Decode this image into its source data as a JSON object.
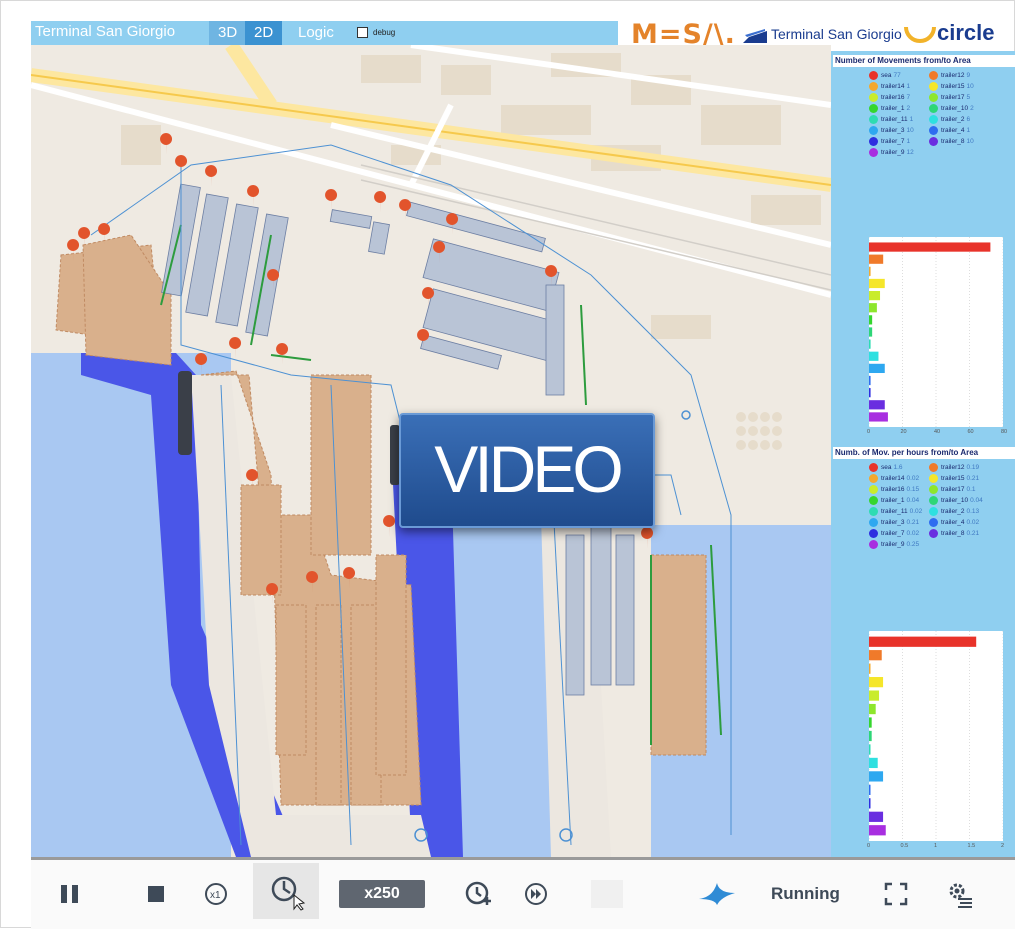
{
  "header": {
    "title": "Terminal San Giorgio",
    "view_tabs": [
      "3D",
      "2D",
      "Logic"
    ],
    "debug_label": "debug",
    "brand_mesa": "M=S/\\.",
    "brand_terminal": "Terminal San Giorgio",
    "brand_circle": "circle"
  },
  "video_overlay": {
    "label": "VIDEO"
  },
  "panel_movements": {
    "title": "Number of Movements from/to Area",
    "legend": [
      {
        "name": "sea",
        "value": "77",
        "color": "#e8332a"
      },
      {
        "name": "trailer12",
        "value": "9",
        "color": "#f07a2a"
      },
      {
        "name": "trailer14",
        "value": "1",
        "color": "#f3a82e"
      },
      {
        "name": "trailer15",
        "value": "10",
        "color": "#f5e62a"
      },
      {
        "name": "trailer16",
        "value": "7",
        "color": "#c9ec2c"
      },
      {
        "name": "trailer17",
        "value": "5",
        "color": "#8ee62c"
      },
      {
        "name": "trailer_1",
        "value": "2",
        "color": "#35d62e"
      },
      {
        "name": "trailer_10",
        "value": "2",
        "color": "#2ed677"
      },
      {
        "name": "trailer_11",
        "value": "1",
        "color": "#2edcb2"
      },
      {
        "name": "trailer_2",
        "value": "6",
        "color": "#2ee0e0"
      },
      {
        "name": "trailer_3",
        "value": "10",
        "color": "#2ea8f0"
      },
      {
        "name": "trailer_4",
        "value": "1",
        "color": "#2e6cf0"
      },
      {
        "name": "trailer_7",
        "value": "1",
        "color": "#2e2ee0"
      },
      {
        "name": "trailer_8",
        "value": "10",
        "color": "#6a2ee0"
      },
      {
        "name": "trailer_9",
        "value": "12",
        "color": "#a82ee0"
      }
    ],
    "axis_ticks": [
      "0",
      "20",
      "40",
      "60",
      "80"
    ]
  },
  "panel_hourly": {
    "title": "Numb. of Mov. per hours from/to Area",
    "legend": [
      {
        "name": "sea",
        "value": "1.6",
        "color": "#e8332a"
      },
      {
        "name": "trailer12",
        "value": "0.19",
        "color": "#f07a2a"
      },
      {
        "name": "trailer14",
        "value": "0.02",
        "color": "#f3a82e"
      },
      {
        "name": "trailer15",
        "value": "0.21",
        "color": "#f5e62a"
      },
      {
        "name": "trailer16",
        "value": "0.15",
        "color": "#c9ec2c"
      },
      {
        "name": "trailer17",
        "value": "0.1",
        "color": "#8ee62c"
      },
      {
        "name": "trailer_1",
        "value": "0.04",
        "color": "#35d62e"
      },
      {
        "name": "trailer_10",
        "value": "0.04",
        "color": "#2ed677"
      },
      {
        "name": "trailer_11",
        "value": "0.02",
        "color": "#2edcb2"
      },
      {
        "name": "trailer_2",
        "value": "0.13",
        "color": "#2ee0e0"
      },
      {
        "name": "trailer_3",
        "value": "0.21",
        "color": "#2ea8f0"
      },
      {
        "name": "trailer_4",
        "value": "0.02",
        "color": "#2e6cf0"
      },
      {
        "name": "trailer_7",
        "value": "0.02",
        "color": "#2e2ee0"
      },
      {
        "name": "trailer_8",
        "value": "0.21",
        "color": "#6a2ee0"
      },
      {
        "name": "trailer_9",
        "value": "0.25",
        "color": "#a82ee0"
      }
    ],
    "axis_ticks": [
      "0",
      "0.5",
      "1",
      "1.5",
      "2"
    ]
  },
  "chart_data": [
    {
      "type": "bar",
      "title": "Number of Movements from/to Area",
      "orientation": "horizontal",
      "categories": [
        "sea",
        "trailer12",
        "trailer14",
        "trailer15",
        "trailer16",
        "trailer17",
        "trailer_1",
        "trailer_10",
        "trailer_11",
        "trailer_2",
        "trailer_3",
        "trailer_4",
        "trailer_7",
        "trailer_8",
        "trailer_9"
      ],
      "values": [
        77,
        9,
        1,
        10,
        7,
        5,
        2,
        2,
        1,
        6,
        10,
        1,
        1,
        10,
        12
      ],
      "xlim": [
        0,
        85
      ]
    },
    {
      "type": "bar",
      "title": "Numb. of Mov. per hours from/to Area",
      "orientation": "horizontal",
      "categories": [
        "sea",
        "trailer12",
        "trailer14",
        "trailer15",
        "trailer16",
        "trailer17",
        "trailer_1",
        "trailer_10",
        "trailer_11",
        "trailer_2",
        "trailer_3",
        "trailer_4",
        "trailer_7",
        "trailer_8",
        "trailer_9"
      ],
      "values": [
        1.6,
        0.19,
        0.02,
        0.21,
        0.15,
        0.1,
        0.04,
        0.04,
        0.02,
        0.13,
        0.21,
        0.02,
        0.02,
        0.21,
        0.25
      ],
      "xlim": [
        0,
        2
      ]
    }
  ],
  "toolbar": {
    "speed_label": "x250",
    "status": "Running",
    "icons": [
      "pause-icon",
      "stop-icon",
      "x1-icon",
      "clock-cursor-icon",
      "clock-plus-icon",
      "fast-forward-icon",
      "logo-icon",
      "fullscreen-icon",
      "settings-icon"
    ]
  },
  "colors": {
    "header_bg": "#8fcff0",
    "water_light": "#a9c8f2",
    "water_dark": "#4a56e8",
    "yard": "#d9b08c",
    "marker": "#e2542c"
  }
}
